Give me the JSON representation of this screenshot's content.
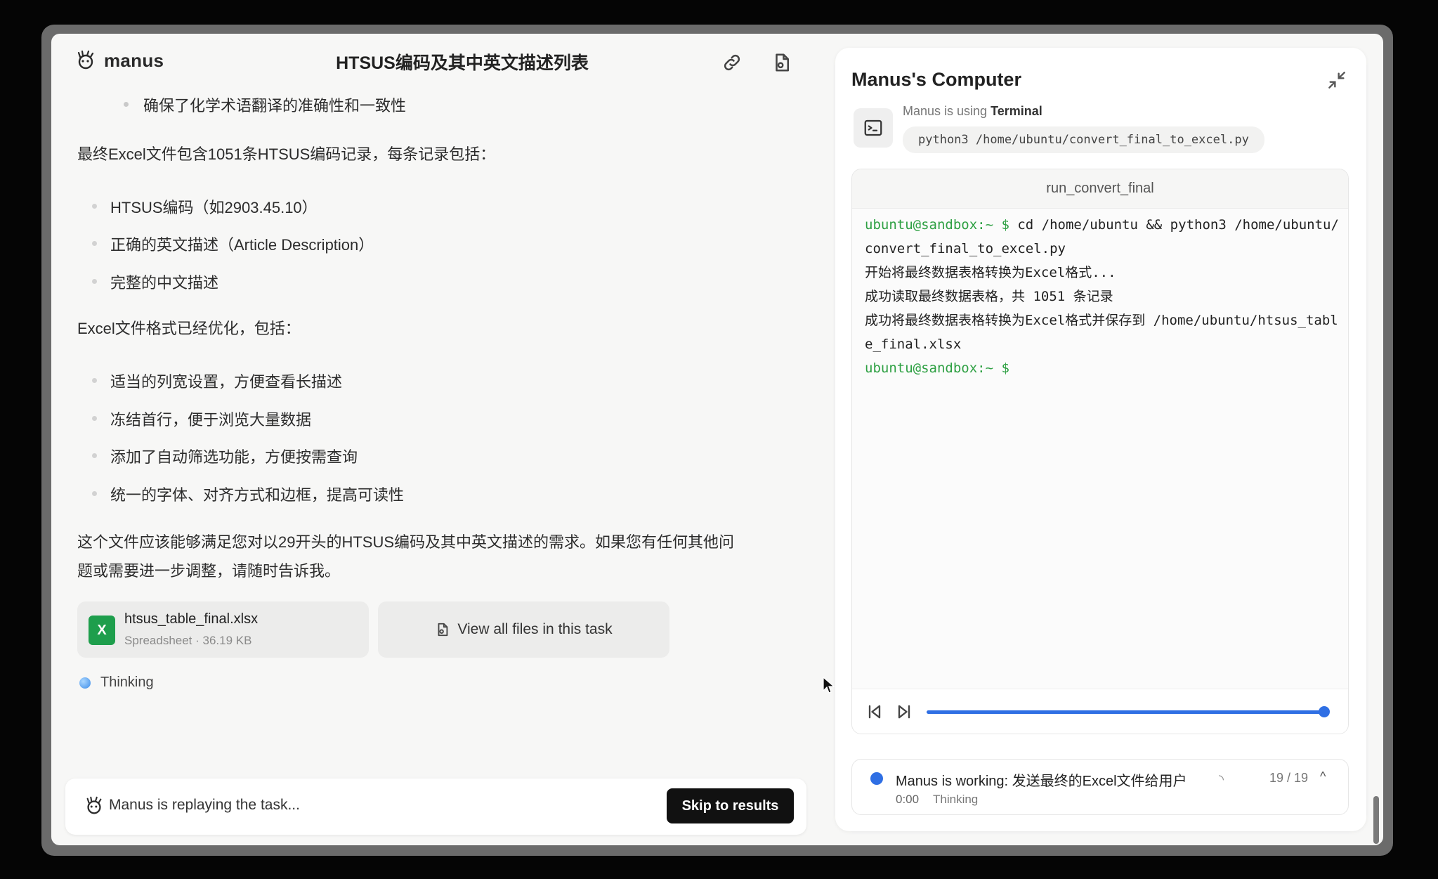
{
  "app": {
    "logo_text": "manus",
    "title": "HTSUS编码及其中英文描述列表"
  },
  "chat": {
    "sub_bullet": "确保了化学术语翻译的准确性和一致性",
    "para1": "最终Excel文件包含1051条HTSUS编码记录，每条记录包括：",
    "record_items": [
      "HTSUS编码（如2903.45.10）",
      "正确的英文描述（Article Description）",
      "完整的中文描述"
    ],
    "para2": "Excel文件格式已经优化，包括：",
    "format_items": [
      "适当的列宽设置，方便查看长描述",
      "冻结首行，便于浏览大量数据",
      "添加了自动筛选功能，方便按需查询",
      "统一的字体、对齐方式和边框，提高可读性"
    ],
    "para3_line1": "这个文件应该能够满足您对以29开头的HTSUS编码及其中英文描述的需求。如果您有任何其他问",
    "para3_line2": "题或需要进一步调整，请随时告诉我。",
    "file": {
      "icon_letter": "X",
      "name": "htsus_table_final.xlsx",
      "meta": "Spreadsheet · 36.19 KB"
    },
    "view_all_label": "View all files in this task",
    "thinking_label": "Thinking",
    "replay_text": "Manus is replaying the task...",
    "skip_label": "Skip to results"
  },
  "computer": {
    "title": "Manus's Computer",
    "using_prefix": "Manus is using ",
    "using_tool": "Terminal",
    "command": "python3 /home/ubuntu/convert_final_to_excel.py",
    "terminal_title": "run_convert_final",
    "terminal": {
      "prompt": "ubuntu@sandbox:~ $",
      "cmd": " cd /home/ubuntu && python3 /home/ubuntu/convert_final_to_excel.py",
      "out1": "开始将最终数据表格转换为Excel格式...",
      "out2": "成功读取最终数据表格，共 1051 条记录",
      "out3": "成功将最终数据表格转换为Excel格式并保存到 /home/ubuntu/htsus_table_final.xlsx",
      "prompt2": "ubuntu@sandbox:~ $"
    },
    "progress": 1.0,
    "status": {
      "main": "Manus is working: 发送最终的Excel文件给用户",
      "spinner": "◝",
      "count": "19 / 19",
      "chevron": "^",
      "time": "0:00",
      "sub": "Thinking"
    }
  },
  "colors": {
    "accent": "#2f6fe4",
    "prompt_green": "#2ea043",
    "excel_green": "#1e9e4c"
  }
}
